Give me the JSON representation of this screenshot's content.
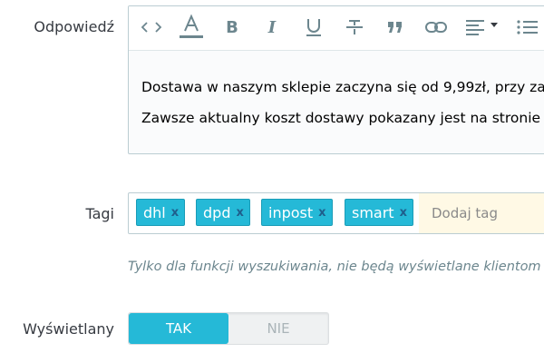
{
  "answer": {
    "label": "Odpowiedź",
    "toolbar": [
      {
        "name": "code-view-button",
        "icon": "code-icon"
      },
      {
        "name": "text-color-button",
        "icon": "text-color-icon",
        "glyph": "A"
      },
      {
        "name": "bold-button",
        "icon": "bold-icon",
        "glyph": "B"
      },
      {
        "name": "italic-button",
        "icon": "italic-icon",
        "glyph": "I"
      },
      {
        "name": "underline-button",
        "icon": "underline-icon",
        "glyph": "U"
      },
      {
        "name": "strikethrough-button",
        "icon": "strikethrough-icon"
      },
      {
        "name": "quote-button",
        "icon": "quote-icon"
      },
      {
        "name": "link-button",
        "icon": "link-icon"
      },
      {
        "name": "align-button",
        "icon": "align-left-icon"
      },
      {
        "name": "list-button",
        "icon": "list-icon"
      }
    ],
    "lines": [
      "Dostawa w naszym sklepie zaczyna się od 9,99zł, przy za",
      "Zawsze aktualny koszt dostawy pokazany jest na stronie"
    ]
  },
  "tags": {
    "label": "Tagi",
    "items": [
      "dhl",
      "dpd",
      "inpost",
      "smart"
    ],
    "remove_glyph": "x",
    "placeholder": "Dodaj tag",
    "hint": "Tylko dla funkcji wyszukiwania, nie będą wyświetlane klientom"
  },
  "visible": {
    "label": "Wyświetlany",
    "yes": "TAK",
    "no": "NIE",
    "selected": "TAK"
  },
  "colors": {
    "accent": "#25b9d7",
    "tag_input_bg": "#fff9e5",
    "icon": "#6c868e"
  }
}
